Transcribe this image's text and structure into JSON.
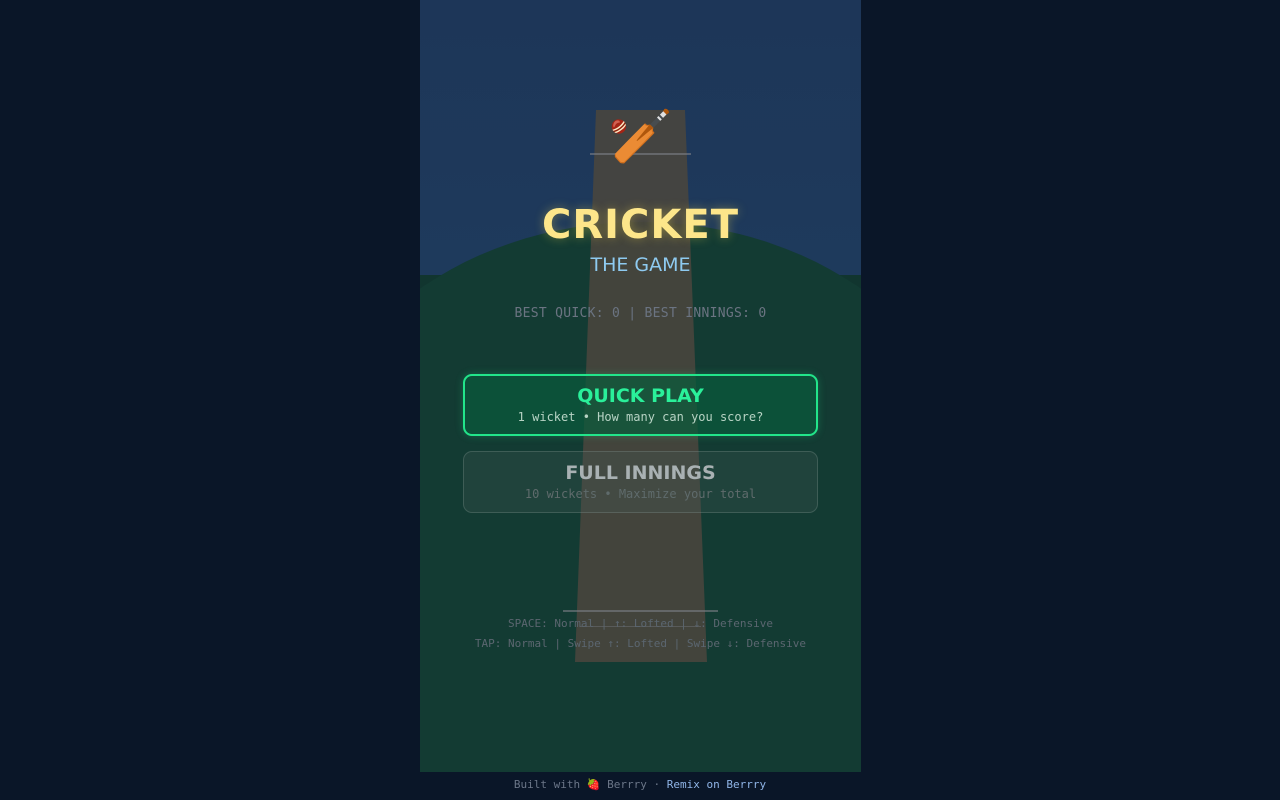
{
  "logo": {
    "icon": "cricket-bat-ball-icon",
    "glyph": "🏏"
  },
  "title": "CRICKET",
  "subtitle": "THE GAME",
  "best_scores": "BEST QUICK: 0 | BEST INNINGS: 0",
  "modes": {
    "quick": {
      "title": "QUICK PLAY",
      "subtitle": "1 wicket • How many can you score?"
    },
    "full": {
      "title": "FULL INNINGS",
      "subtitle": "10 wickets • Maximize your total"
    }
  },
  "controls": {
    "keyboard": "SPACE: Normal | ↑: Lofted | ↓: Defensive",
    "touch": "TAP: Normal | Swipe ↑: Lofted | Swipe ↓: Defensive"
  },
  "footer": {
    "built_with": "Built with",
    "brand_icon": "strawberry-icon",
    "brand_glyph": "🍓",
    "brand": "Berrry",
    "separator": "·",
    "remix_link": "Remix on Berrry"
  },
  "colors": {
    "page_bg": "#0a1628",
    "title": "#fde68a",
    "subtitle": "#8ecaf0",
    "quick_accent": "#22e58a",
    "field": "#133b33",
    "pitch": "#4a463e"
  }
}
